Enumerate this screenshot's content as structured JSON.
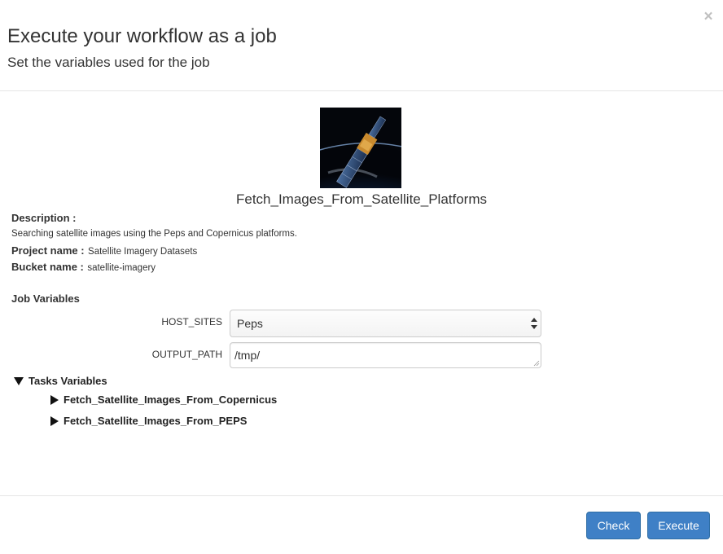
{
  "modal": {
    "title": "Execute your workflow as a job",
    "subtitle": "Set the variables used for the job",
    "close_glyph": "×"
  },
  "workflow": {
    "name": "Fetch_Images_From_Satellite_Platforms",
    "description_label": "Description :",
    "description": "Searching satellite images using the Peps and Copernicus platforms.",
    "project_label": "Project name :",
    "project": "Satellite Imagery Datasets",
    "bucket_label": "Bucket name :",
    "bucket": "satellite-imagery",
    "icon": "satellite-image"
  },
  "job_variables": {
    "title": "Job Variables",
    "host_sites_label": "HOST_SITES",
    "host_sites_value": "Peps",
    "output_path_label": "OUTPUT_PATH",
    "output_path_value": "/tmp/"
  },
  "tasks": {
    "title": "Tasks Variables",
    "items": [
      "Fetch_Satellite_Images_From_Copernicus",
      "Fetch_Satellite_Images_From_PEPS"
    ]
  },
  "buttons": {
    "check": "Check",
    "execute": "Execute"
  },
  "colors": {
    "primary": "#3f80c6",
    "border": "#e5e5e5"
  }
}
